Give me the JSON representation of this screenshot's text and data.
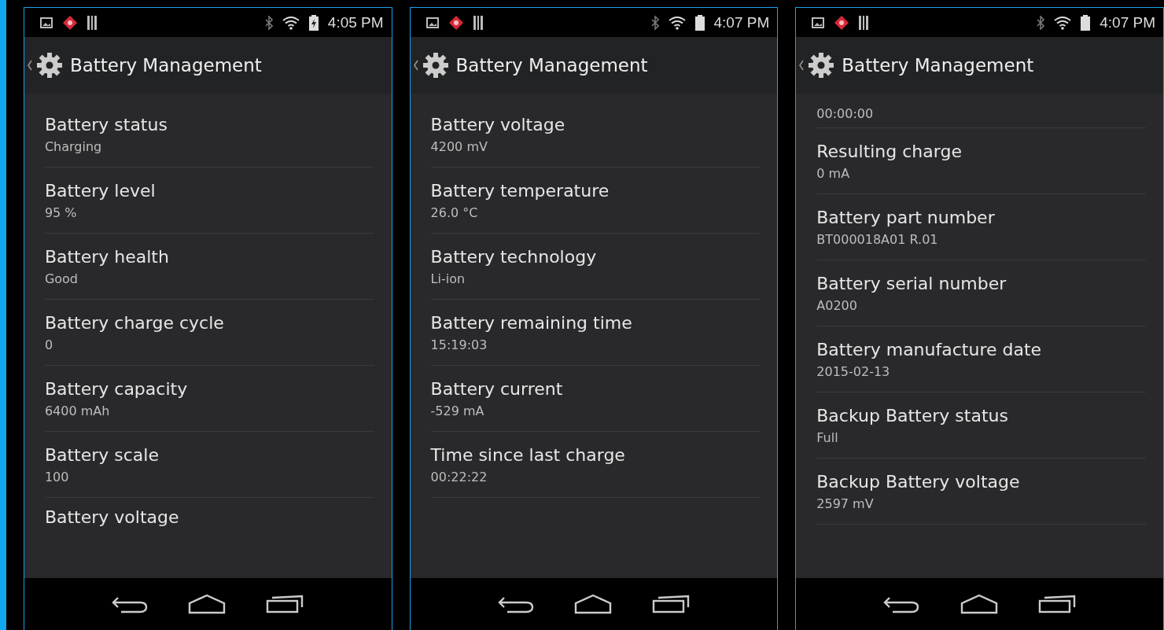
{
  "screens": [
    {
      "status_bar": {
        "time": "4:05 PM",
        "charging": true
      },
      "title": "Battery Management",
      "items": [
        {
          "kind": "full",
          "title": "Battery status",
          "value": "Charging"
        },
        {
          "kind": "full",
          "title": "Battery level",
          "value": "95 %"
        },
        {
          "kind": "full",
          "title": "Battery health",
          "value": "Good"
        },
        {
          "kind": "full",
          "title": "Battery charge cycle",
          "value": "0"
        },
        {
          "kind": "full",
          "title": "Battery capacity",
          "value": "6400 mAh"
        },
        {
          "kind": "full",
          "title": "Battery scale",
          "value": "100"
        },
        {
          "kind": "title_only",
          "title": "Battery voltage"
        }
      ]
    },
    {
      "status_bar": {
        "time": "4:07 PM",
        "charging": false
      },
      "title": "Battery Management",
      "items": [
        {
          "kind": "full",
          "title": "Battery voltage",
          "value": "4200 mV"
        },
        {
          "kind": "full",
          "title": "Battery temperature",
          "value": "26.0 °C"
        },
        {
          "kind": "full",
          "title": "Battery technology",
          "value": "Li-ion"
        },
        {
          "kind": "full",
          "title": "Battery remaining time",
          "value": "15:19:03"
        },
        {
          "kind": "full",
          "title": "Battery current",
          "value": "-529 mA"
        },
        {
          "kind": "full",
          "title": "Time since last charge",
          "value": "00:22:22"
        }
      ]
    },
    {
      "status_bar": {
        "time": "4:07 PM",
        "charging": false
      },
      "title": "Battery Management",
      "items": [
        {
          "kind": "value_only",
          "value": "00:00:00"
        },
        {
          "kind": "full",
          "title": "Resulting charge",
          "value": "0 mA"
        },
        {
          "kind": "full",
          "title": "Battery part number",
          "value": "BT000018A01 R.01"
        },
        {
          "kind": "full",
          "title": "Battery serial number",
          "value": "A0200"
        },
        {
          "kind": "full",
          "title": "Battery manufacture date",
          "value": "2015-02-13"
        },
        {
          "kind": "full",
          "title": "Backup Battery status",
          "value": "Full"
        },
        {
          "kind": "full",
          "title": "Backup Battery voltage",
          "value": "2597 mV"
        }
      ]
    }
  ]
}
